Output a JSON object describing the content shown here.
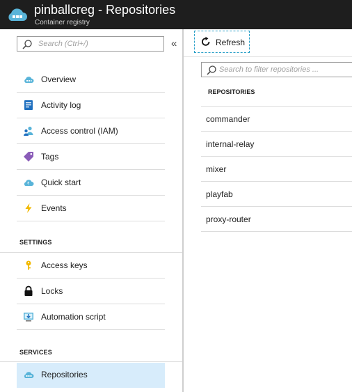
{
  "header": {
    "title": "pinballcreg - Repositories",
    "subtitle": "Container registry"
  },
  "sidebar": {
    "search_placeholder": "Search (Ctrl+/)",
    "collapse_glyph": "«",
    "items": [
      {
        "label": "Overview",
        "icon": "cloud-icon"
      },
      {
        "label": "Activity log",
        "icon": "log-icon"
      },
      {
        "label": "Access control (IAM)",
        "icon": "users-icon"
      },
      {
        "label": "Tags",
        "icon": "tag-icon"
      },
      {
        "label": "Quick start",
        "icon": "cloud-icon"
      },
      {
        "label": "Events",
        "icon": "lightning-icon"
      }
    ],
    "settings_label": "SETTINGS",
    "settings_items": [
      {
        "label": "Access keys",
        "icon": "key-icon"
      },
      {
        "label": "Locks",
        "icon": "lock-icon"
      },
      {
        "label": "Automation script",
        "icon": "download-icon"
      }
    ],
    "services_label": "SERVICES",
    "services_items": [
      {
        "label": "Repositories",
        "icon": "cloud-icon",
        "selected": true
      }
    ]
  },
  "main": {
    "refresh_label": "Refresh",
    "filter_placeholder": "Search to filter repositories ...",
    "column_header": "REPOSITORIES",
    "repositories": [
      "commander",
      "internal-relay",
      "mixer",
      "playfab",
      "proxy-router"
    ]
  },
  "colors": {
    "header_bg": "#1e1e1e",
    "selected_bg": "#d7ecfb",
    "accent": "#2aa0c8"
  }
}
